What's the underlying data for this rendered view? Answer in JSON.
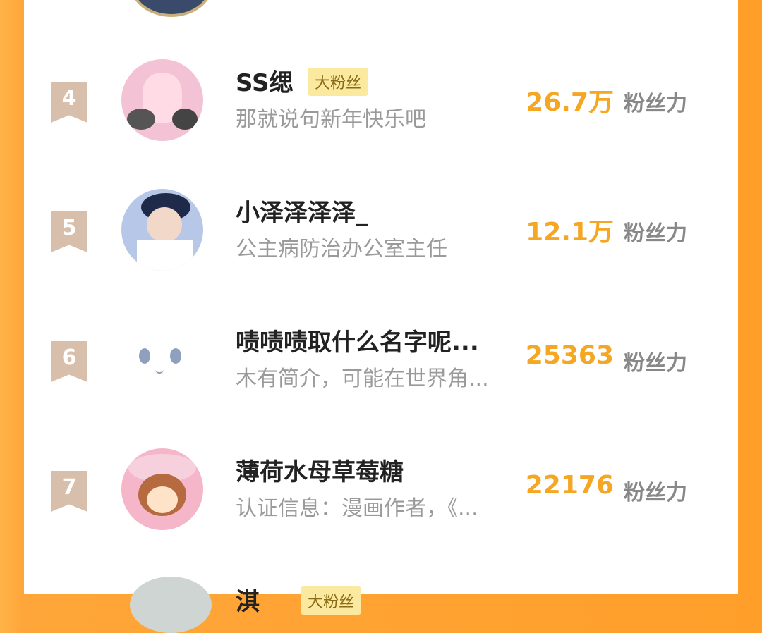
{
  "rows": [
    {
      "rank": "4",
      "name": "SS缌",
      "badge": "大粉丝",
      "bio": "那就说句新年快乐吧",
      "score": "26.7万",
      "unit": "粉丝力",
      "avatar_color": "#f3c2d4"
    },
    {
      "rank": "5",
      "name": "小泽泽泽泽_",
      "badge": "",
      "bio": "公主病防治办公室主任",
      "score": "12.1万",
      "unit": "粉丝力",
      "avatar_color": "#b7c7e8"
    },
    {
      "rank": "6",
      "name": "啧啧啧取什么名字呢...",
      "badge": "",
      "bio": "木有简介，可能在世界角...",
      "score": "25363",
      "unit": "粉丝力",
      "avatar_color": "#ffffff"
    },
    {
      "rank": "7",
      "name": "薄荷水母草莓糖",
      "badge": "",
      "bio": "认证信息：漫画作者，《...",
      "score": "22176",
      "unit": "粉丝力",
      "avatar_color": "#f4b6c8"
    }
  ],
  "partial_bottom": {
    "name": "淇",
    "badge": "大粉丝"
  },
  "colors": {
    "accent": "#f5a623",
    "badge_bg": "#fbe9a0",
    "rank_bg": "#d8bfab",
    "border": "#ff9f2a"
  }
}
